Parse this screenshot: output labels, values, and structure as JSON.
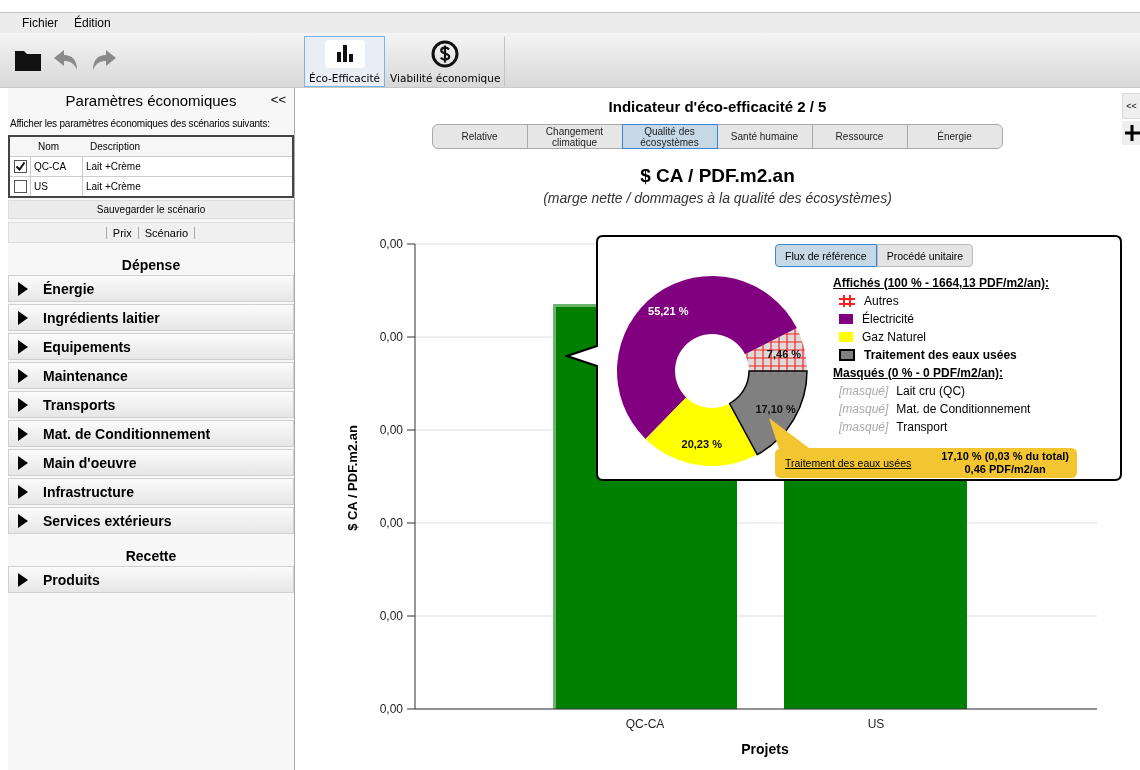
{
  "menu": [
    {
      "label": "Fichier"
    },
    {
      "label": "Édition"
    }
  ],
  "toolbar": {
    "actions": [
      {
        "kind": "open",
        "disabled": false
      },
      {
        "kind": "undo",
        "disabled": true
      },
      {
        "kind": "redo",
        "disabled": true
      }
    ],
    "modules": [
      {
        "kind": "chart",
        "label": "Éco-Efficacité",
        "selected": true
      },
      {
        "kind": "dollar",
        "label": "Viabilité économique",
        "selected": false
      }
    ]
  },
  "sidebar": {
    "title": "Paramètres économiques",
    "collapse": "<<",
    "hint": "Afficher les paramètres économiques des scénarios suivants:",
    "table": {
      "columns": [
        "Nom",
        "Description"
      ],
      "rows": [
        {
          "checked": true,
          "name": "QC-CA",
          "description": "Lait +Crème"
        },
        {
          "checked": false,
          "name": "US",
          "description": "Lait +Crème"
        }
      ]
    },
    "save_button": "Sauvegarder le scénario",
    "subtabs": [
      {
        "label": "Prix"
      },
      {
        "label": "Scénario"
      }
    ],
    "sections": [
      {
        "title": "Dépense",
        "items": [
          {
            "label": "Énergie",
            "expanded": false
          },
          {
            "label": "Ingrédients laitier",
            "expanded": false
          },
          {
            "label": "Equipements",
            "expanded": false
          },
          {
            "label": "Maintenance",
            "expanded": false
          },
          {
            "label": "Transports",
            "expanded": false
          },
          {
            "label": "Mat. de Conditionnement",
            "expanded": false
          },
          {
            "label": "Main d'oeuvre",
            "expanded": false
          },
          {
            "label": "Infrastructure",
            "expanded": false
          },
          {
            "label": "Services extérieurs",
            "expanded": false
          }
        ]
      },
      {
        "title": "Recette",
        "items": [
          {
            "label": "Produits",
            "expanded": false
          }
        ]
      }
    ]
  },
  "main": {
    "title": "Indicateur d'éco-efficacité 2 / 5",
    "tabs": [
      {
        "label": "Relative",
        "selected": false
      },
      {
        "label": "Changement climatique",
        "selected": false
      },
      {
        "label": "Qualité des écosystèmes",
        "selected": true
      },
      {
        "label": "Santé humaine",
        "selected": false
      },
      {
        "label": "Ressource",
        "selected": false
      },
      {
        "label": "Énergie",
        "selected": false
      }
    ],
    "chart_title": "$ CA / PDF.m2.an",
    "chart_subtitle": "(marge nette / dommages à la qualité des écosystèmes)",
    "bar_chart": {
      "ylabel": "$ CA / PDF.m2.an",
      "xlabel": "Projets",
      "ytick_labels": [
        "0,00",
        "0,00",
        "0,00",
        "0,00",
        "0,00",
        "0,00"
      ],
      "categories": [
        "QC-CA",
        "US"
      ]
    },
    "popup": {
      "modes": [
        {
          "label": "Flux de référence",
          "selected": true
        },
        {
          "label": "Procédé unitaire",
          "selected": false
        }
      ],
      "chart_data": {
        "type": "donut",
        "categories": [
          "Autres",
          "Électricité",
          "Gaz Naturel",
          "Traitement des eaux usées"
        ],
        "values": [
          7.46,
          55.21,
          20.23,
          17.1
        ],
        "value_labels": [
          "7,46 %",
          "55,21 %",
          "20,23 %",
          "17,10 %"
        ]
      },
      "shown_heading": "Affichés (100 % - 1664,13 PDF/m2/an):",
      "legend": [
        {
          "color": "#ff2020",
          "kind": "hatch",
          "selected": false
        },
        {
          "color": "#800080",
          "kind": "solid",
          "selected": false
        },
        {
          "color": "#ffff00",
          "kind": "solid",
          "selected": false
        },
        {
          "color": "#808080",
          "kind": "solid",
          "selected": true
        }
      ],
      "hidden_heading": "Masqués (0 % - 0 PDF/m2/an):",
      "hidden": [
        {
          "tag": "[masqué]",
          "label": "Lait cru (QC)"
        },
        {
          "tag": "[masqué]",
          "label": "Mat. de Conditionnement"
        },
        {
          "tag": "[masqué]",
          "label": "Transport"
        }
      ],
      "tooltip": {
        "name": "Traitement des eaux usées",
        "line_1": "17,10 % (0,03 % du total)",
        "line_2": "0,46 PDF/m2/an"
      }
    }
  },
  "edge_buttons": {
    "collapse": "<<"
  }
}
